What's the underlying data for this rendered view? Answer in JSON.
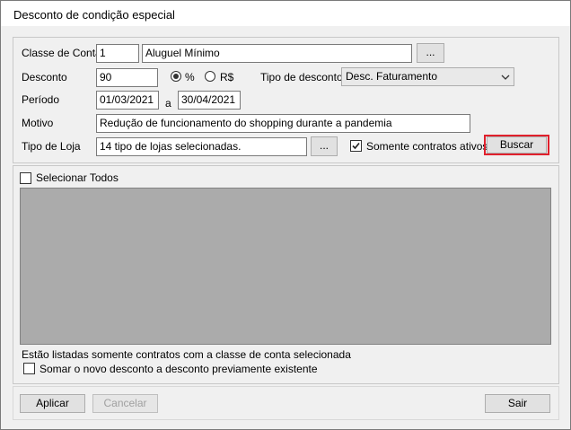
{
  "window": {
    "title": "Desconto de condição especial"
  },
  "form": {
    "classe_label": "Classe de Conta",
    "classe_code": "1",
    "classe_name": "Aluguel Mínimo",
    "ellipsis": "...",
    "desconto_label": "Desconto",
    "desconto_value": "90",
    "pct_label": "%",
    "rs_label": "R$",
    "tipo_desconto_label": "Tipo de desconto",
    "tipo_desconto_value": "Desc. Faturamento",
    "periodo_label": "Período",
    "periodo_start": "01/03/2021",
    "periodo_sep": "a",
    "periodo_end": "30/04/2021",
    "motivo_label": "Motivo",
    "motivo_value": "Redução de funcionamento do shopping durante a pandemia",
    "tipo_loja_label": "Tipo de Loja",
    "tipo_loja_value": "14 tipo de lojas selecionadas.",
    "somente_label": "Somente contratos ativos",
    "buscar_label": "Buscar"
  },
  "list": {
    "select_all_label": "Selecionar Todos",
    "info_text": "Estão listadas somente contratos com a classe de conta selecionada",
    "somar_label": "Somar o novo desconto a desconto previamente existente"
  },
  "footer": {
    "aplicar_label": "Aplicar",
    "cancelar_label": "Cancelar",
    "sair_label": "Sair"
  },
  "colors": {
    "highlight": "#e0202c",
    "grid_bg": "#ababab"
  }
}
